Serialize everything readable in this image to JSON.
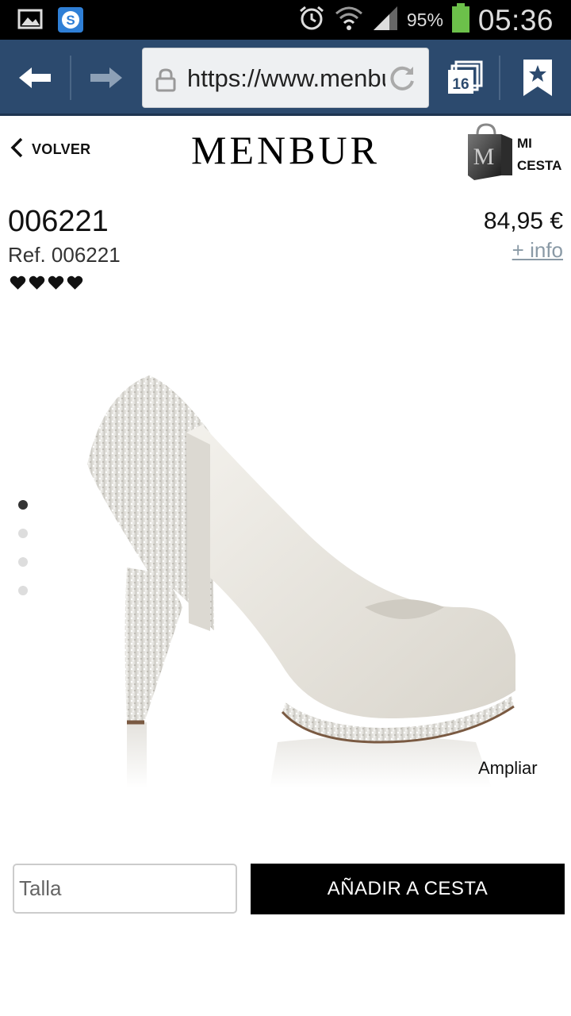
{
  "status_bar": {
    "battery_percent": "95%",
    "time": "05:36",
    "icons": [
      "gallery-icon",
      "skype-icon",
      "alarm-icon",
      "wifi-icon",
      "signal-icon",
      "battery-icon"
    ]
  },
  "browser": {
    "url": "https://www.menbur.com",
    "tab_count": "16",
    "icons": [
      "back-arrow-icon",
      "forward-arrow-icon",
      "lock-icon",
      "reload-icon",
      "tabs-icon",
      "bookmark-star-icon"
    ]
  },
  "header": {
    "back_label": "VOLVER",
    "logo": "MENBUR",
    "cart_label_line1": "MI",
    "cart_label_line2": "CESTA"
  },
  "product": {
    "name": "006221",
    "reference": "Ref. 006221",
    "rating": 4,
    "price": "84,95 €",
    "more_info": "+ info"
  },
  "gallery": {
    "image_count": 4,
    "active_index": 0,
    "zoom_label": "Ampliar"
  },
  "purchase": {
    "size_placeholder": "Talla",
    "size_value": "",
    "add_to_cart": "AÑADIR A CESTA"
  },
  "colors": {
    "browser_bar": "#2c4a6e",
    "button_bg": "#000000",
    "info_link": "#8a9aa6"
  }
}
